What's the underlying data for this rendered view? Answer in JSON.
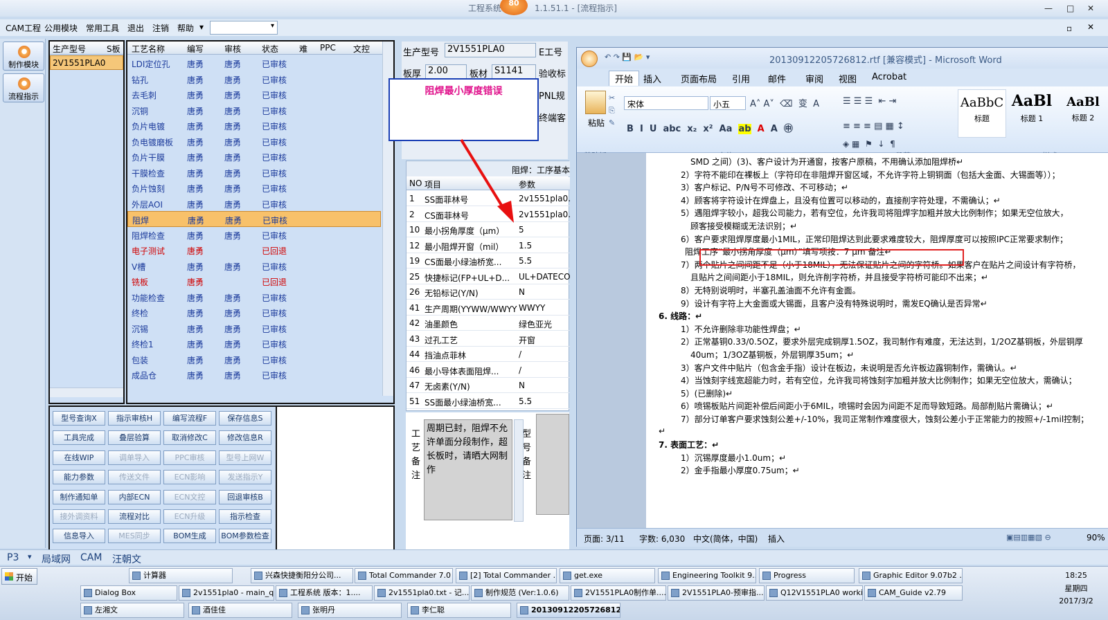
{
  "app": {
    "title_left": "工程系统",
    "badge": "80",
    "title_right": "1.1.51.1 - [流程指示]"
  },
  "menu": [
    "CAM工程",
    "公用模块",
    "常用工具",
    "退出",
    "注销",
    "帮助"
  ],
  "nav": [
    {
      "label": "制作模块"
    },
    {
      "label": "流程指示"
    }
  ],
  "model_grid": {
    "headers": [
      "生产型号",
      "S板"
    ],
    "row": "2V1551PLA0"
  },
  "process_grid": {
    "headers": [
      "工艺名称",
      "编写",
      "审核",
      "状态",
      "难",
      "PPC",
      "文控"
    ],
    "rows": [
      {
        "name": "LDI定位孔",
        "writer": "唐勇",
        "reviewer": "唐勇",
        "status": "已审核"
      },
      {
        "name": "钻孔",
        "writer": "唐勇",
        "reviewer": "唐勇",
        "status": "已审核"
      },
      {
        "name": "去毛刺",
        "writer": "唐勇",
        "reviewer": "唐勇",
        "status": "已审核"
      },
      {
        "name": "沉铜",
        "writer": "唐勇",
        "reviewer": "唐勇",
        "status": "已审核"
      },
      {
        "name": "负片电镀",
        "writer": "唐勇",
        "reviewer": "唐勇",
        "status": "已审核"
      },
      {
        "name": "负电镀磨板",
        "writer": "唐勇",
        "reviewer": "唐勇",
        "status": "已审核"
      },
      {
        "name": "负片干膜",
        "writer": "唐勇",
        "reviewer": "唐勇",
        "status": "已审核"
      },
      {
        "name": "干膜检查",
        "writer": "唐勇",
        "reviewer": "唐勇",
        "status": "已审核"
      },
      {
        "name": "负片蚀刻",
        "writer": "唐勇",
        "reviewer": "唐勇",
        "status": "已审核"
      },
      {
        "name": "外层AOI",
        "writer": "唐勇",
        "reviewer": "唐勇",
        "status": "已审核"
      },
      {
        "name": "阻焊",
        "writer": "唐勇",
        "reviewer": "唐勇",
        "status": "已审核"
      },
      {
        "name": "阻焊检查",
        "writer": "唐勇",
        "reviewer": "唐勇",
        "status": "已审核"
      },
      {
        "name": "电子测试",
        "writer": "唐勇",
        "reviewer": "",
        "status": "已回退"
      },
      {
        "name": "V槽",
        "writer": "唐勇",
        "reviewer": "唐勇",
        "status": "已审核"
      },
      {
        "name": "铣板",
        "writer": "唐勇",
        "reviewer": "",
        "status": "已回退"
      },
      {
        "name": "功能检查",
        "writer": "唐勇",
        "reviewer": "唐勇",
        "status": "已审核"
      },
      {
        "name": "终检",
        "writer": "唐勇",
        "reviewer": "唐勇",
        "status": "已审核"
      },
      {
        "name": "沉锡",
        "writer": "唐勇",
        "reviewer": "唐勇",
        "status": "已审核"
      },
      {
        "name": "终检1",
        "writer": "唐勇",
        "reviewer": "唐勇",
        "status": "已审核"
      },
      {
        "name": "包装",
        "writer": "唐勇",
        "reviewer": "唐勇",
        "status": "已审核"
      },
      {
        "name": "成品仓",
        "writer": "唐勇",
        "reviewer": "唐勇",
        "status": "已审核"
      }
    ]
  },
  "buttons": [
    "型号查询X",
    "指示审核H",
    "编写流程F",
    "保存信息S",
    "工具完成",
    "叠层验算",
    "取消修改C",
    "修改信息R",
    "在线WIP",
    "调单导入",
    "PPC审核",
    "型号上网W",
    "能力参数",
    "传送文件",
    "ECN影响",
    "发送指示Y",
    "制作通知单",
    "内部ECN",
    "ECN文控",
    "回退审核B",
    "接外调资料",
    "流程对比",
    "ECN升级",
    "指示检查",
    "信息导入",
    "MES同步",
    "BOM生成",
    "BOM参数检查"
  ],
  "info": {
    "model_label": "生产型号",
    "model_value": "2V1551PLA0",
    "e_label": "E工号",
    "thick_label": "板厚",
    "thick_value": "2.00",
    "mat_label": "板材",
    "mat_value": "S1141",
    "accept_label": "验收标",
    "pnl_label": "PNL规",
    "final_label": "终端客"
  },
  "callout": "阻焊最小厚度错误",
  "params": {
    "title": "阻焊：工序基本参",
    "headers": [
      "NO",
      "项目",
      "参数"
    ],
    "rows": [
      {
        "no": "1",
        "item": "SS面菲林号",
        "val": "2v1551pla0."
      },
      {
        "no": "2",
        "item": "CS面菲林号",
        "val": "2v1551pla0."
      },
      {
        "no": "10",
        "item": "最小拐角厚度（μm）",
        "val": "5"
      },
      {
        "no": "12",
        "item": "最小阻焊开窗（mil）",
        "val": "1.5"
      },
      {
        "no": "19",
        "item": "CS面最小绿油桥宽...",
        "val": "5.5"
      },
      {
        "no": "25",
        "item": "快捷标记(FP+UL+D...",
        "val": "UL+DATECODE"
      },
      {
        "no": "26",
        "item": "无铅标记(Y/N)",
        "val": "N"
      },
      {
        "no": "41",
        "item": "生产周期(YYWW/WWYY)",
        "val": "WWYY"
      },
      {
        "no": "42",
        "item": "油墨颜色",
        "val": "绿色亚光"
      },
      {
        "no": "43",
        "item": "过孔工艺",
        "val": "开窗"
      },
      {
        "no": "44",
        "item": "挡油点菲林",
        "val": "/"
      },
      {
        "no": "46",
        "item": "最小导体表面阻焊...",
        "val": "/"
      },
      {
        "no": "47",
        "item": "无卤素(Y/N)",
        "val": "N"
      },
      {
        "no": "51",
        "item": "SS面最小绿油桥宽...",
        "val": "5.5"
      }
    ]
  },
  "notes": {
    "label1": "工艺备注",
    "text": "周期已封，阻焊不允许单面分段制作，超长板时，请晒大网制作",
    "label2": "型号备注"
  },
  "word": {
    "title": "20130912205726812.rtf [兼容模式] - Microsoft Word",
    "tabs": [
      "开始",
      "插入",
      "页面布局",
      "引用",
      "邮件",
      "审阅",
      "视图",
      "Acrobat"
    ],
    "font": "宋体",
    "size": "小五",
    "groups": [
      "剪贴板",
      "字体",
      "段落",
      "样式"
    ],
    "paste": "粘贴",
    "styles": [
      {
        "preview": "AaBbC",
        "name": "标题"
      },
      {
        "preview": "AaBl",
        "name": "标题 1"
      },
      {
        "preview": "AaBl",
        "name": "标题 2"
      }
    ],
    "lines": [
      "SMD 之间）(3)、客户设计为开通窗，按客户原稿，不用确认添加阻焊桥↵",
      "2）字符不能印在裸板上（字符印在非阻焊开窗区域，不允许字符上铜铜面（包括大金面、大锡面等））；",
      "3）客户标记、P/N号不可修改、不可移动；↵",
      "4）顾客将字符设计在焊盘上，且没有位置可以移动的，直接削字符处理，不需确认；↵",
      "5）遇阻焊字较小，超我公司能力，若有空位，允许我司将阻焊字加粗并放大比例制作；如果无空位放大，",
      "顾客接受模糊或无法识别；↵",
      "6）客户要求阻焊厚度最小1MIL，正常印阻焊达到此要求难度较大，阻焊厚度可以按照IPC正常要求制作；",
      "阻焊工序“最小拐角厚度（μm）”填写项按：7  μm 备注↵",
      "7）两个贴片之间间距不足（小于18MIL），无法保证贴片之间的字符桥。如果客户在贴片之间设计有字符桥，",
      "且贴片之间间距小于18MIL，则允许削字符桥，并且接受字符桥可能印不出来；↵",
      "8）无特别说明时，半塞孔盖油面不允许有金面。",
      "9）设计有字符上大金面或大锡面，且客户没有特殊说明时，需发EQ确认是否异常↵",
      "6.  线路：↵",
      "1）不允许删除非功能性焊盘；↵",
      "2）正常基铜0.33/0.5OZ，要求外层完成铜厚1.5OZ，我司制作有难度，无法达到，1/2OZ基铜板，外层铜厚",
      "40um；1/3OZ基铜板，外层铜厚35um；↵",
      "3）客户文件中贴片（包含金手指）设计在板边，未说明是否允许板边露铜制作，需确认。↵",
      "4）当蚀刻字线宽超能力时，若有空位，允许我司将蚀刻字加粗并放大比例制作；如果无空位放大，需确认；",
      "5）(已删除)↵",
      "6）喷锡板贴片间距补偿后间距小于6MIL，喷锡时会因为间距不足而导致短路。局部削贴片需确认；↵",
      "7）部分订单客户要求蚀刻公差+/-10%，我司正常制作难度很大，蚀刻公差小于正常能力的按照+/-1mil控制；",
      "↵",
      "7.  表面工艺：↵",
      "1）沉锡厚度最小1.0um；↵",
      "2）金手指最小厚度0.75um；↵"
    ],
    "status": {
      "page": "页面: 3/11",
      "words": "字数: 6,030",
      "lang": "中文(简体，中国)",
      "mode": "插入",
      "zoom": "90%"
    }
  },
  "statusbar": [
    "P3",
    "局域网",
    "CAM",
    "汪朝文"
  ],
  "taskbar": {
    "start": "开始",
    "row1": [
      "计算器",
      "兴森快捷衡阳分公司...",
      "Total Commander 7.0 ...",
      "[2] Total Commander ...",
      "get.exe",
      "Engineering Toolkit 9....",
      "Progress",
      "Graphic Editor 9.07b2 ..."
    ],
    "row2": [
      "Dialog Box",
      "2v1551pla0 - main_qa",
      "工程系统  版本：1....",
      "2v1551pla0.txt - 记...",
      "制作规范 (Ver:1.0.6)",
      "2V1551PLA0制作单....",
      "2V1551PLA0-预审指...",
      "Q12V1551PLA0 worki...",
      "CAM_Guide v2.79"
    ],
    "row3": [
      "左湘文",
      "酒佳佳",
      "张明丹",
      "李仁聪",
      "20130912205726812...."
    ],
    "time": "18:25",
    "weekday": "星期四",
    "date": "2017/3/2"
  }
}
